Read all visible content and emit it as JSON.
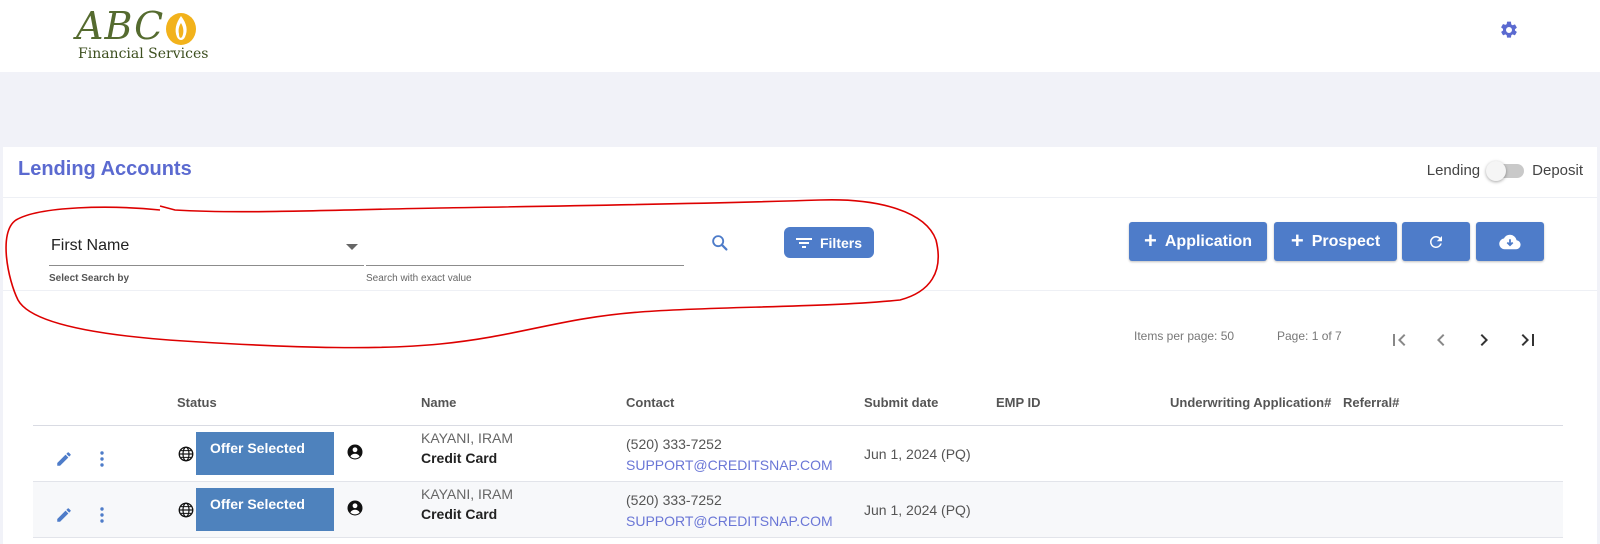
{
  "logo": {
    "brand": "ABC",
    "subtitle": "Financial Services"
  },
  "header": {
    "settings_icon": "gear-icon"
  },
  "page": {
    "title": "Lending Accounts"
  },
  "toggle": {
    "left_label": "Lending",
    "right_label": "Deposit",
    "state": "Lending"
  },
  "search": {
    "select_value": "First Name",
    "select_hint": "Select Search by",
    "input_value": "",
    "input_hint": "Search with exact value"
  },
  "toolbar": {
    "filters_label": "Filters",
    "application_label": "Application",
    "prospect_label": "Prospect",
    "refresh_icon": "refresh-icon",
    "download_icon": "cloud-download-icon"
  },
  "pagination": {
    "items_per_page": "Items per page: 50",
    "page_info": "Page: 1 of 7"
  },
  "table": {
    "columns": {
      "status": "Status",
      "name": "Name",
      "contact": "Contact",
      "submit_date": "Submit date",
      "emp_id": "EMP ID",
      "underwriting": "Underwriting Application#",
      "referral": "Referral#"
    },
    "rows": [
      {
        "status": "Offer Selected",
        "name": "KAYANI, IRAM",
        "product": "Credit Card",
        "phone": "(520) 333-7252",
        "email": "SUPPORT@CREDITSNAP.COM",
        "submit_date": "Jun 1, 2024 (PQ)",
        "emp_id": "",
        "underwriting": "",
        "referral": ""
      },
      {
        "status": "Offer Selected",
        "name": "KAYANI, IRAM",
        "product": "Credit Card",
        "phone": "(520) 333-7252",
        "email": "SUPPORT@CREDITSNAP.COM",
        "submit_date": "Jun 1, 2024 (PQ)",
        "emp_id": "",
        "underwriting": "",
        "referral": ""
      }
    ]
  },
  "colors": {
    "accent": "#4e7cc9",
    "title": "#5b6ad0",
    "status_badge": "#4e82bd",
    "annotation": "#dd0000"
  }
}
